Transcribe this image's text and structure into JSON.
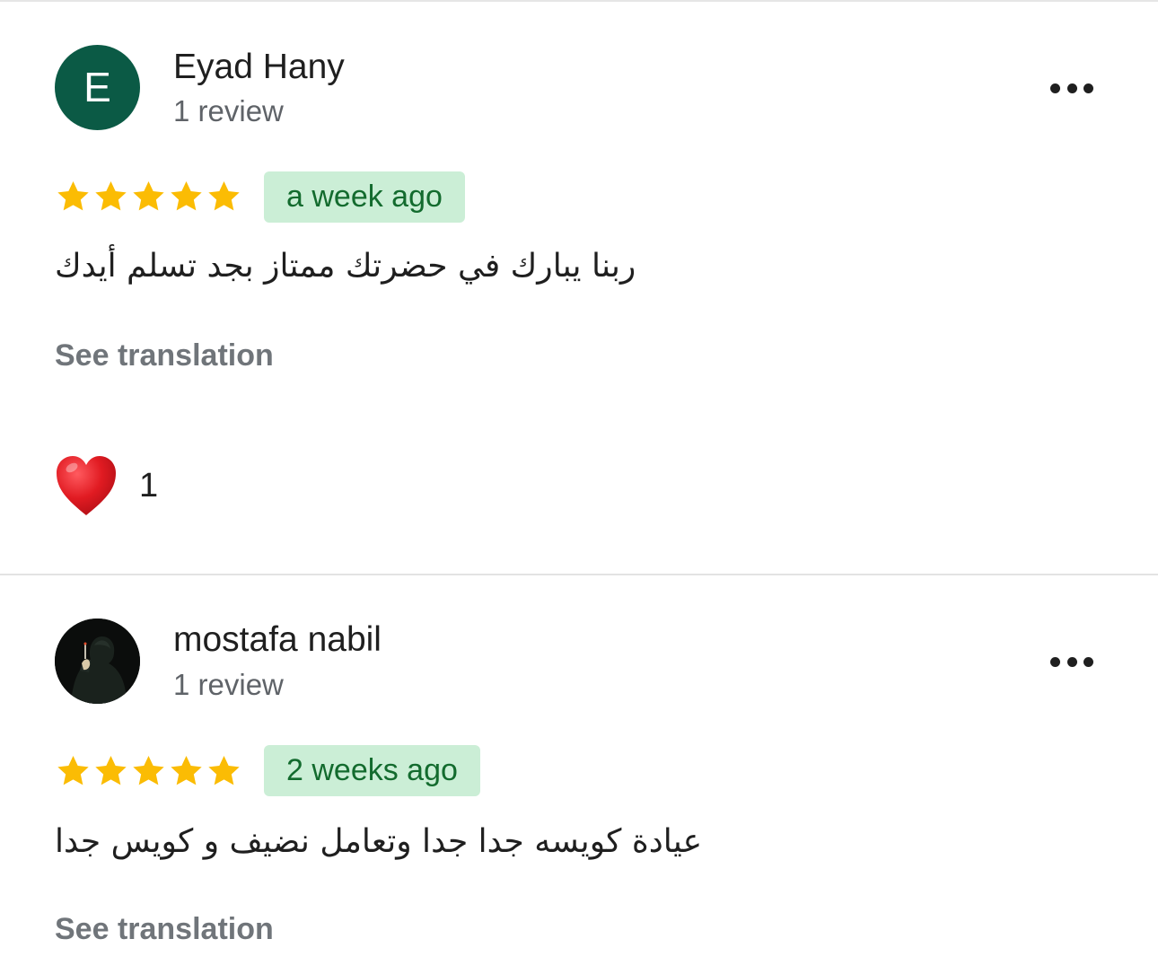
{
  "colors": {
    "star": "#FBBC04",
    "badge_bg": "#CBEED6",
    "badge_text": "#136B2E",
    "avatar1_bg": "#0B5A45",
    "heart": "#E11B22"
  },
  "reviews": [
    {
      "avatar_letter": "E",
      "name": "Eyad Hany",
      "review_count": "1 review",
      "rating": 5,
      "date": "a week ago",
      "text": "ربنا يبارك في حضرتك ممتاز بجد تسلم أيدك",
      "translate_label": "See translation",
      "more_icon": "more-horizontal-icon",
      "reaction": {
        "icon": "heart-icon",
        "count": "1"
      }
    },
    {
      "avatar_icon": "profile-photo",
      "name": "mostafa nabil",
      "review_count": "1 review",
      "rating": 5,
      "date": "2 weeks ago",
      "text": "عيادة كويسه جدا جدا وتعامل نضيف و كويس جدا",
      "translate_label": "See translation",
      "more_icon": "more-horizontal-icon"
    }
  ]
}
